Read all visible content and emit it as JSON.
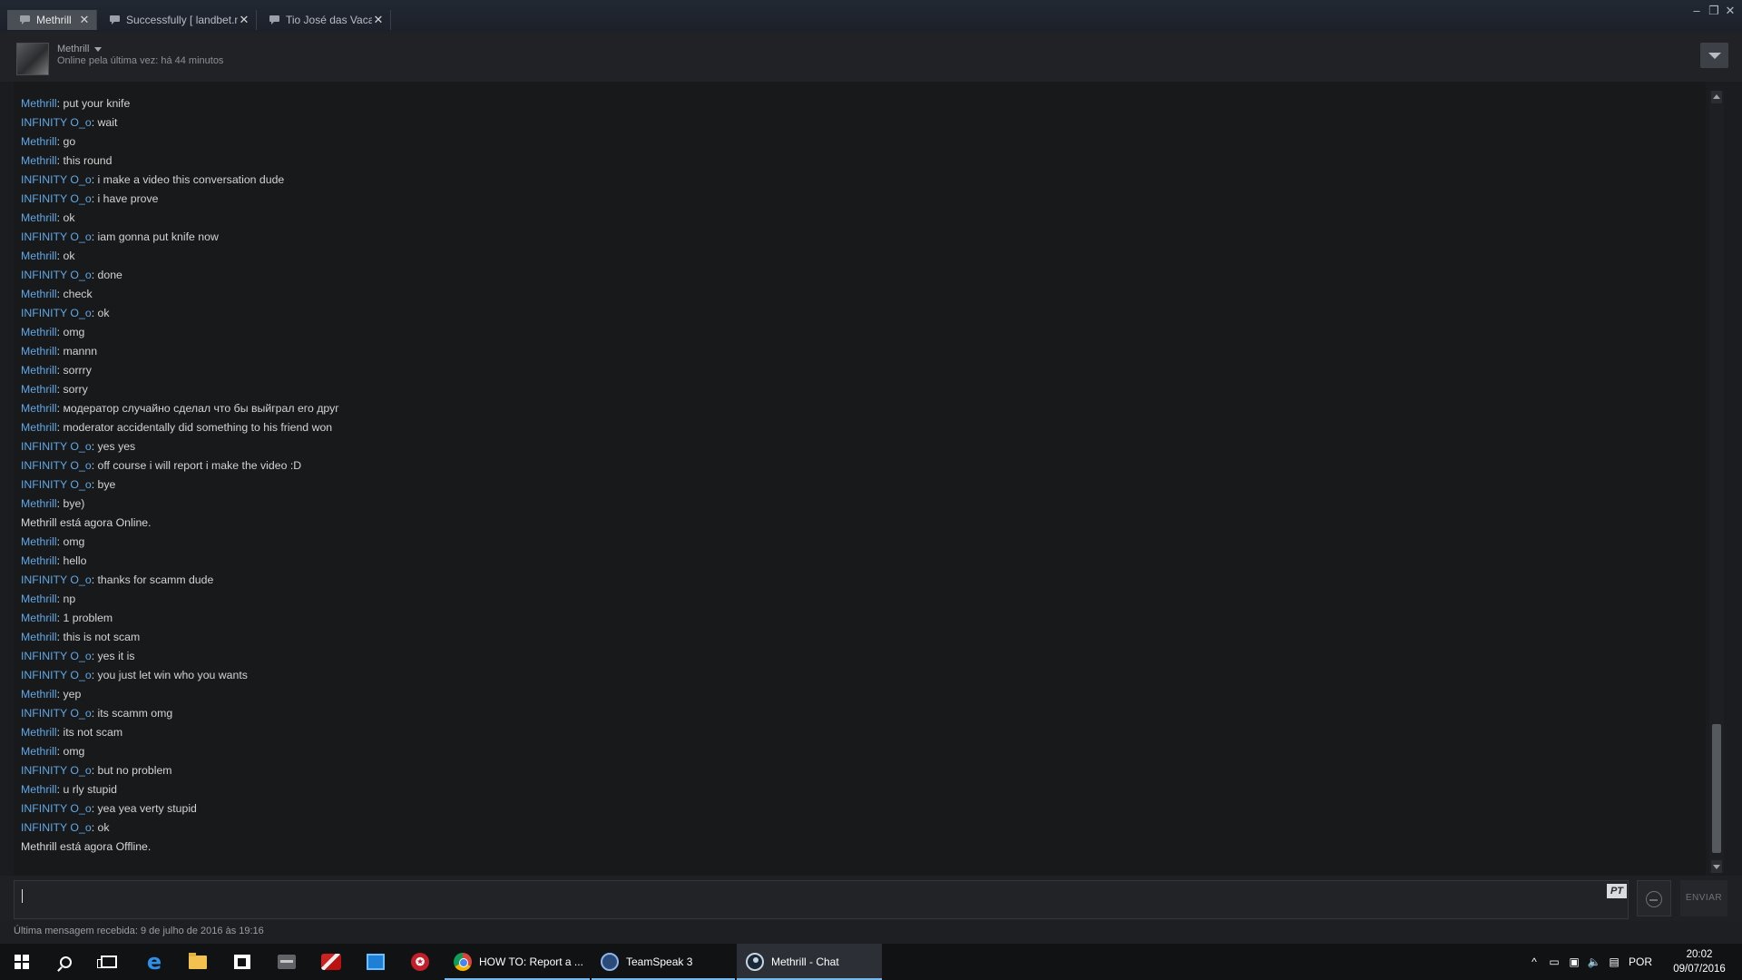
{
  "tabs": [
    {
      "label": "Methrill",
      "active": true
    },
    {
      "label": "Successfully [ landbet.net ]",
      "active": false
    },
    {
      "label": "Tio José das Vacas",
      "active": false
    }
  ],
  "tab_close_glyph": "✕",
  "window_controls": {
    "minimize": "–",
    "restore": "❐",
    "close": "✕"
  },
  "header": {
    "friend_name": "Methrill",
    "status": "Online pela última vez: há 44 minutos"
  },
  "messages": [
    {
      "who": "Methrill",
      "text": ": put your knife"
    },
    {
      "who": "INFINITY O_o",
      "text": ": wait"
    },
    {
      "who": "Methrill",
      "text": ": go"
    },
    {
      "who": "Methrill",
      "text": ": this round"
    },
    {
      "who": "INFINITY O_o",
      "text": ": i make a video this conversation dude"
    },
    {
      "who": "INFINITY O_o",
      "text": ": i have prove"
    },
    {
      "who": "Methrill",
      "text": ": ok"
    },
    {
      "who": "INFINITY O_o",
      "text": ": iam gonna put knife now"
    },
    {
      "who": "Methrill",
      "text": ": ok"
    },
    {
      "who": "INFINITY O_o",
      "text": ": done"
    },
    {
      "who": "Methrill",
      "text": ": check"
    },
    {
      "who": "INFINITY O_o",
      "text": ": ok"
    },
    {
      "who": "Methrill",
      "text": ": omg"
    },
    {
      "who": "Methrill",
      "text": ": mannn"
    },
    {
      "who": "Methrill",
      "text": ": sorrry"
    },
    {
      "who": "Methrill",
      "text": ": sorry"
    },
    {
      "who": "Methrill",
      "text": ": модератор случайно сделал что бы выйграл его друг"
    },
    {
      "who": "Methrill",
      "text": ": moderator accidentally did something to his friend won"
    },
    {
      "who": "INFINITY O_o",
      "text": ": yes yes"
    },
    {
      "who": "INFINITY O_o",
      "text": ": off course i will report i make the video :D"
    },
    {
      "who": "INFINITY O_o",
      "text": ": bye"
    },
    {
      "who": "Methrill",
      "text": ": bye)"
    },
    {
      "who": "",
      "text": "Methrill está agora Online."
    },
    {
      "who": "Methrill",
      "text": ": omg"
    },
    {
      "who": "Methrill",
      "text": ": hello"
    },
    {
      "who": "INFINITY O_o",
      "text": ": thanks for scamm dude"
    },
    {
      "who": "Methrill",
      "text": ": np"
    },
    {
      "who": "Methrill",
      "text": ": 1 problem"
    },
    {
      "who": "Methrill",
      "text": ": this is not scam"
    },
    {
      "who": "INFINITY O_o",
      "text": ": yes it is"
    },
    {
      "who": "INFINITY O_o",
      "text": ": you just let win who you wants"
    },
    {
      "who": "Methrill",
      "text": ": yep"
    },
    {
      "who": "INFINITY O_o",
      "text": ": its scamm omg"
    },
    {
      "who": "Methrill",
      "text": ": its not scam"
    },
    {
      "who": "Methrill",
      "text": ": omg"
    },
    {
      "who": "INFINITY O_o",
      "text": ": but no problem"
    },
    {
      "who": "Methrill",
      "text": ": u rly stupid"
    },
    {
      "who": "INFINITY O_o",
      "text": ": yea yea verty stupid"
    },
    {
      "who": "INFINITY O_o",
      "text": ": ok"
    },
    {
      "who": "",
      "text": "Methrill está agora Offline."
    }
  ],
  "input": {
    "value": "",
    "lang_badge": "PT",
    "send_label": "ENVIAR"
  },
  "footer": {
    "last_message": "Última mensagem recebida: 9 de julho de 2016 às 19:16"
  },
  "taskbar": {
    "tasks": [
      {
        "label": "HOW TO: Report a ...",
        "icon": "chrome-icon"
      },
      {
        "label": "TeamSpeak 3",
        "icon": "teamspeak-icon"
      },
      {
        "label": "Methrill - Chat",
        "icon": "steam-icon",
        "active": true
      }
    ],
    "lang": "POR",
    "time": "20:02",
    "date": "09/07/2016"
  },
  "colors": {
    "name_link": "#62a7e3",
    "accent_underline": "#76b9ed",
    "background": "#18191b"
  }
}
